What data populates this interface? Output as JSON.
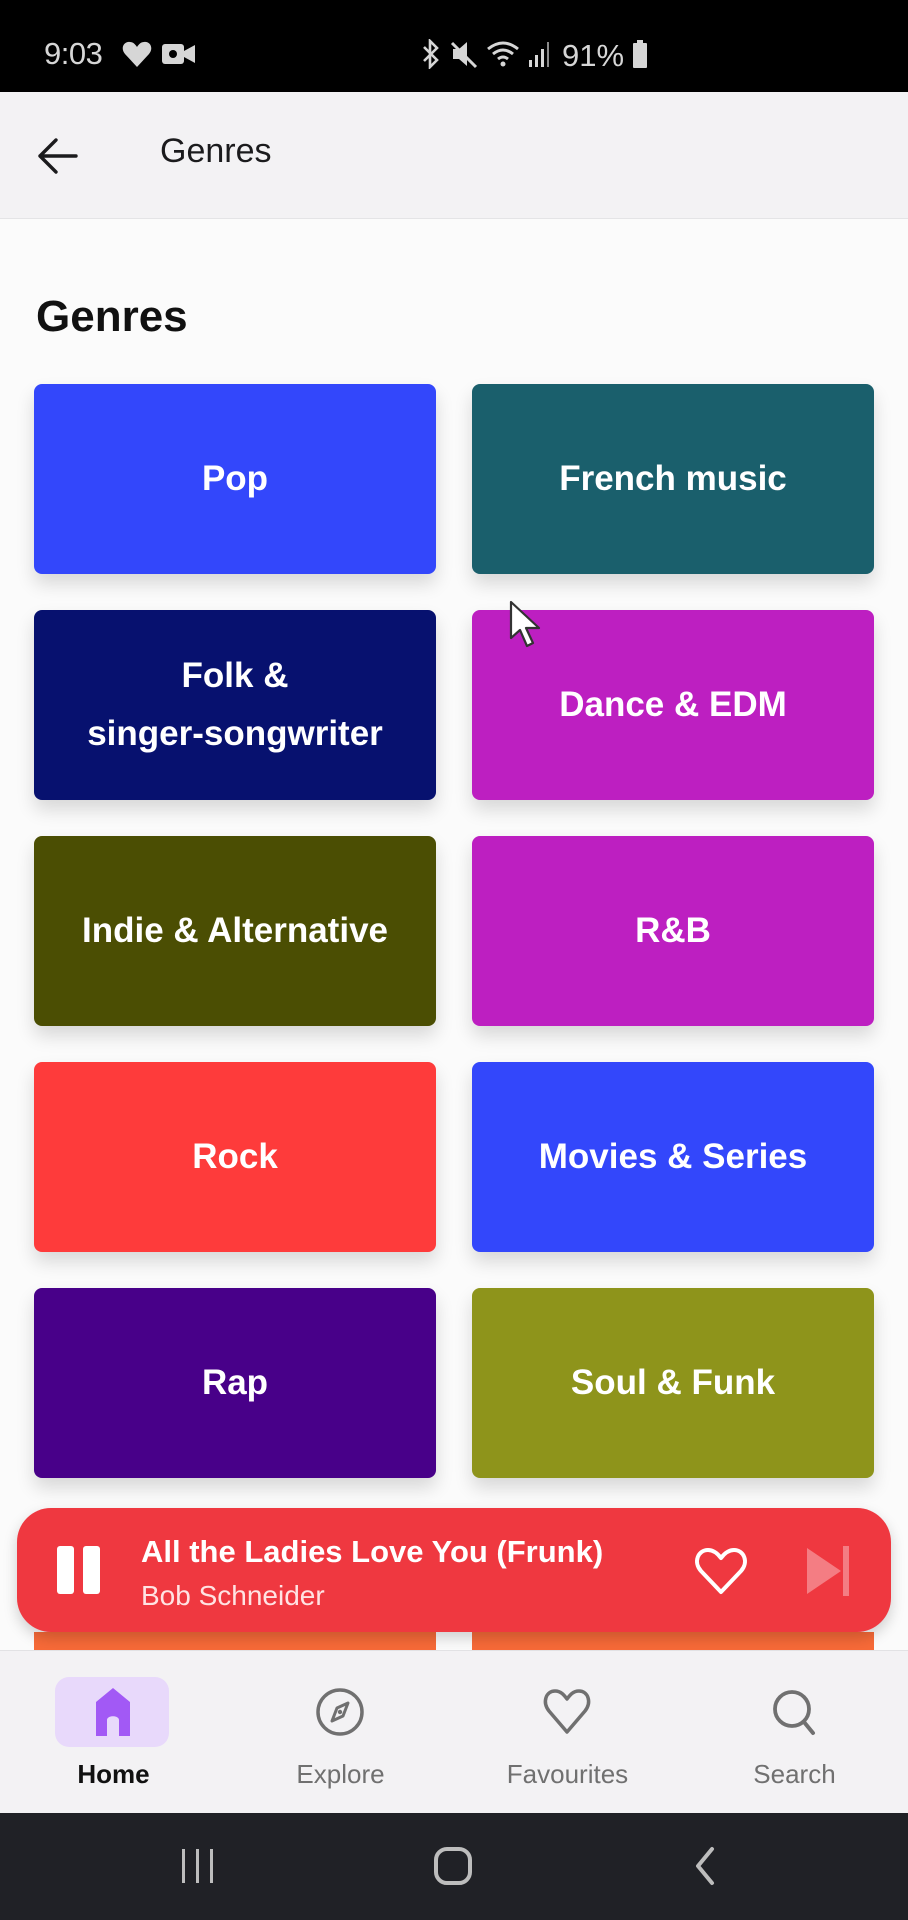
{
  "status_bar": {
    "time": "9:03",
    "left_icons": [
      "health-heart-icon",
      "video-record-icon"
    ],
    "right_icons": [
      "bluetooth-icon",
      "mute-icon",
      "wifi-icon",
      "signal-icon"
    ],
    "battery_percent": "91%"
  },
  "app_bar": {
    "back_icon": "arrow-left-icon",
    "title": "Genres"
  },
  "section": {
    "title": "Genres"
  },
  "genres": [
    {
      "label_lines": [
        "Pop"
      ],
      "color": "#3347fb"
    },
    {
      "label_lines": [
        "French music"
      ],
      "color": "#1a5f6c"
    },
    {
      "label_lines": [
        "Folk &",
        "singer-songwriter"
      ],
      "color": "#07116f"
    },
    {
      "label_lines": [
        "Dance & EDM"
      ],
      "color": "#bd1fc1"
    },
    {
      "label_lines": [
        "Indie & Alternative"
      ],
      "color": "#4b4e03"
    },
    {
      "label_lines": [
        "R&B"
      ],
      "color": "#bd1fc1"
    },
    {
      "label_lines": [
        "Rock"
      ],
      "color": "#fe3b3b"
    },
    {
      "label_lines": [
        "Movies & Series"
      ],
      "color": "#3347fb"
    },
    {
      "label_lines": [
        "Rap"
      ],
      "color": "#480089"
    },
    {
      "label_lines": [
        "Soul & Funk"
      ],
      "color": "#8e941b"
    }
  ],
  "mini_player": {
    "title": "All the Ladies Love You (Frunk)",
    "artist": "Bob Schneider",
    "background": "#ef3840",
    "controls": [
      "pause-icon",
      "heart-icon",
      "skip-next-icon"
    ]
  },
  "bottom_nav": {
    "items": [
      {
        "label": "Home",
        "icon": "home-icon",
        "active": true
      },
      {
        "label": "Explore",
        "icon": "compass-icon",
        "active": false
      },
      {
        "label": "Favourites",
        "icon": "heart-icon",
        "active": false
      },
      {
        "label": "Search",
        "icon": "search-icon",
        "active": false
      }
    ],
    "active_color": "#a259f5"
  },
  "system_nav": {
    "buttons": [
      "recent-apps-icon",
      "home-circle-icon",
      "back-chevron-icon"
    ]
  }
}
